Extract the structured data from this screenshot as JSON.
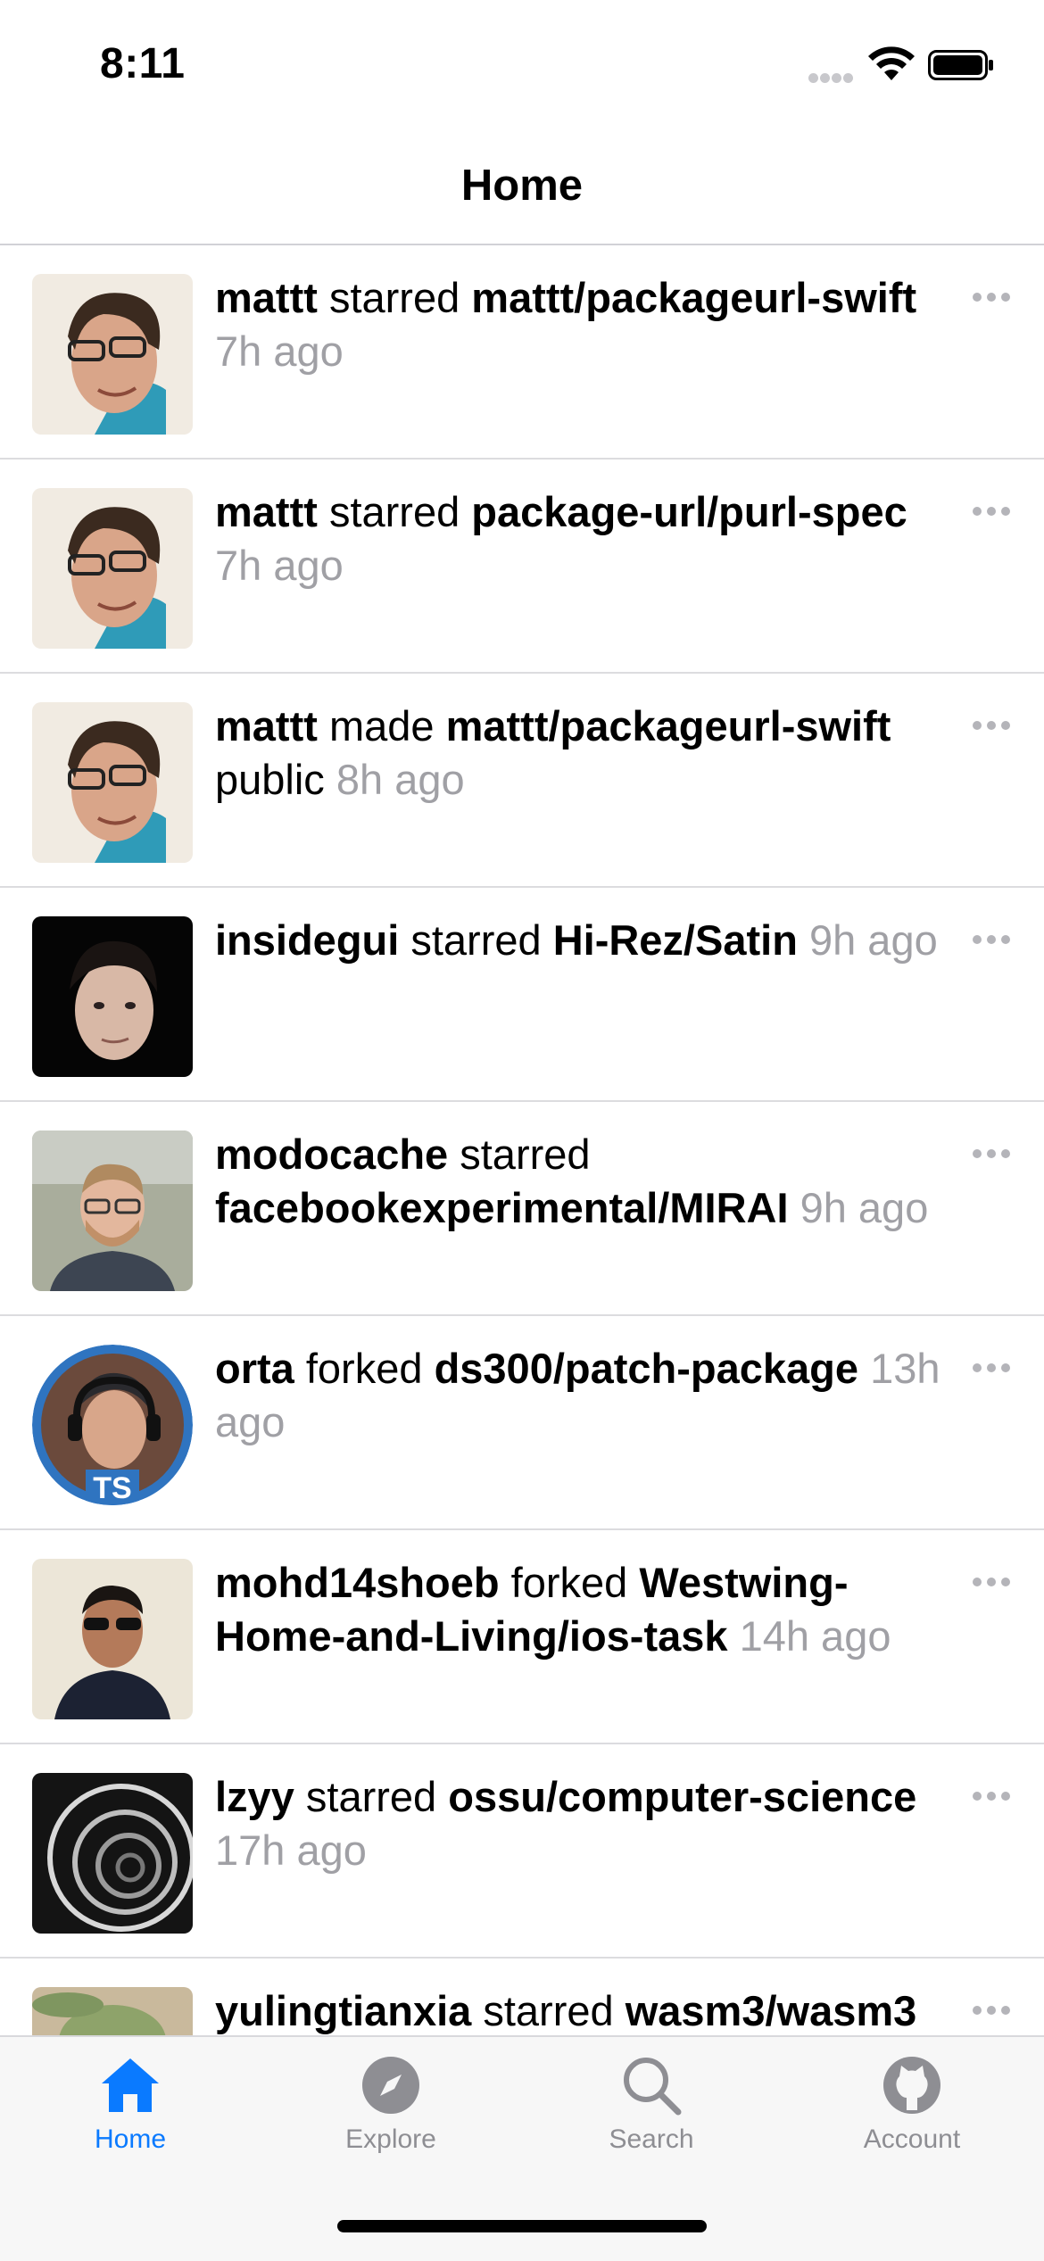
{
  "status": {
    "time": "8:11"
  },
  "nav": {
    "title": "Home"
  },
  "feed": [
    {
      "user": "mattt",
      "action": "starred",
      "repo": "mattt/packageurl-swift",
      "time": "7h ago",
      "avatar": "mattt-avatar"
    },
    {
      "user": "mattt",
      "action": "starred",
      "repo": "package-url/purl-spec",
      "time": "7h ago",
      "avatar": "mattt-avatar"
    },
    {
      "user": "mattt",
      "action": "made",
      "repo": "mattt/packageurl-swift",
      "extra": "public",
      "time": "8h ago",
      "avatar": "mattt-avatar"
    },
    {
      "user": "insidegui",
      "action": "starred",
      "repo": "Hi-Rez/Satin",
      "time": "9h ago",
      "avatar": "insidegui-avatar"
    },
    {
      "user": "modocache",
      "action": "starred",
      "repo": "facebookexperimental/MIRAI",
      "time": "9h ago",
      "avatar": "modocache-avatar"
    },
    {
      "user": "orta",
      "action": "forked",
      "repo": "ds300/patch-package",
      "time": "13h ago",
      "avatar": "orta-avatar",
      "avatar_badge": "TS"
    },
    {
      "user": "mohd14shoeb",
      "action": "forked",
      "repo": "Westwing-Home-and-Living/ios-task",
      "time": "14h ago",
      "avatar": "mohd14shoeb-avatar"
    },
    {
      "user": "lzyy",
      "action": "starred",
      "repo": "ossu/computer-science",
      "time": "17h ago",
      "avatar": "lzyy-avatar"
    },
    {
      "user": "yulingtianxia",
      "action": "starred",
      "repo": "wasm3/wasm3",
      "time": "",
      "avatar": "yulingtianxia-avatar"
    }
  ],
  "tabs": [
    {
      "label": "Home",
      "icon": "house-icon",
      "active": true
    },
    {
      "label": "Explore",
      "icon": "compass-icon",
      "active": false
    },
    {
      "label": "Search",
      "icon": "magnifier-icon",
      "active": false
    },
    {
      "label": "Account",
      "icon": "octocat-icon",
      "active": false
    }
  ],
  "colors": {
    "accent": "#0a7aff",
    "secondary_text": "#a0a0a5",
    "tab_inactive": "#8e8e93"
  }
}
